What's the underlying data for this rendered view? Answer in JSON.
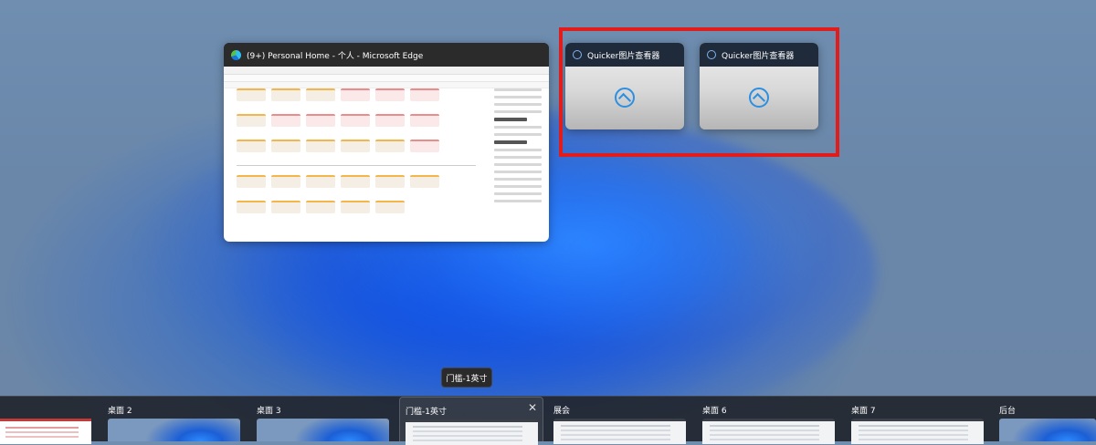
{
  "windows": {
    "edge": {
      "title": "(9+) Personal Home - 个人 - Microsoft Edge",
      "icon": "edge-icon"
    },
    "quicker_1": {
      "title": "Quicker图片查看器",
      "icon": "image-viewer-icon"
    },
    "quicker_2": {
      "title": "Quicker图片查看器",
      "icon": "image-viewer-icon"
    }
  },
  "highlight_color": "#e21b1b",
  "tooltip": {
    "text": "门槛-1英寸"
  },
  "desktops": [
    {
      "label": ""
    },
    {
      "label": "桌面 2"
    },
    {
      "label": "桌面 3"
    },
    {
      "label": "门槛-1英寸",
      "active": true
    },
    {
      "label": "展会"
    },
    {
      "label": "桌面 6"
    },
    {
      "label": "桌面 7"
    },
    {
      "label": "后台"
    }
  ],
  "close_glyph": "✕"
}
